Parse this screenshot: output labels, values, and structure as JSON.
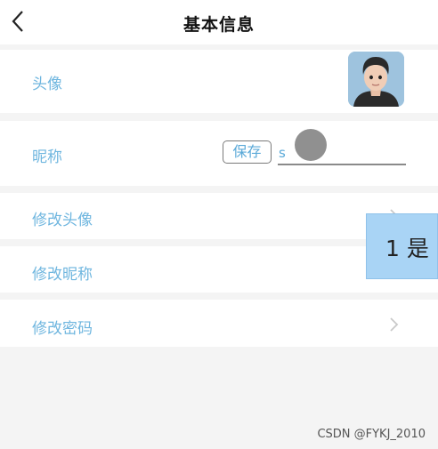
{
  "header": {
    "title": "基本信息",
    "back_icon": "chevron-left-icon"
  },
  "rows": {
    "avatar": {
      "label": "头像"
    },
    "nickname": {
      "label": "昵称",
      "save_label": "保存",
      "input_value": "s"
    },
    "modify_avatar": {
      "label": "修改头像",
      "icon": "chevron-right-icon"
    },
    "modify_nickname": {
      "label": "修改昵称",
      "icon": "chevron-right-icon"
    },
    "modify_password": {
      "label": "修改密码",
      "icon": "chevron-right-icon"
    }
  },
  "tooltip": {
    "text": "1 是"
  },
  "watermark": "CSDN @FYKJ_2010",
  "colors": {
    "label": "#6fb6df",
    "background": "#f4f4f4",
    "tooltip_bg": "#a9d4f5"
  }
}
